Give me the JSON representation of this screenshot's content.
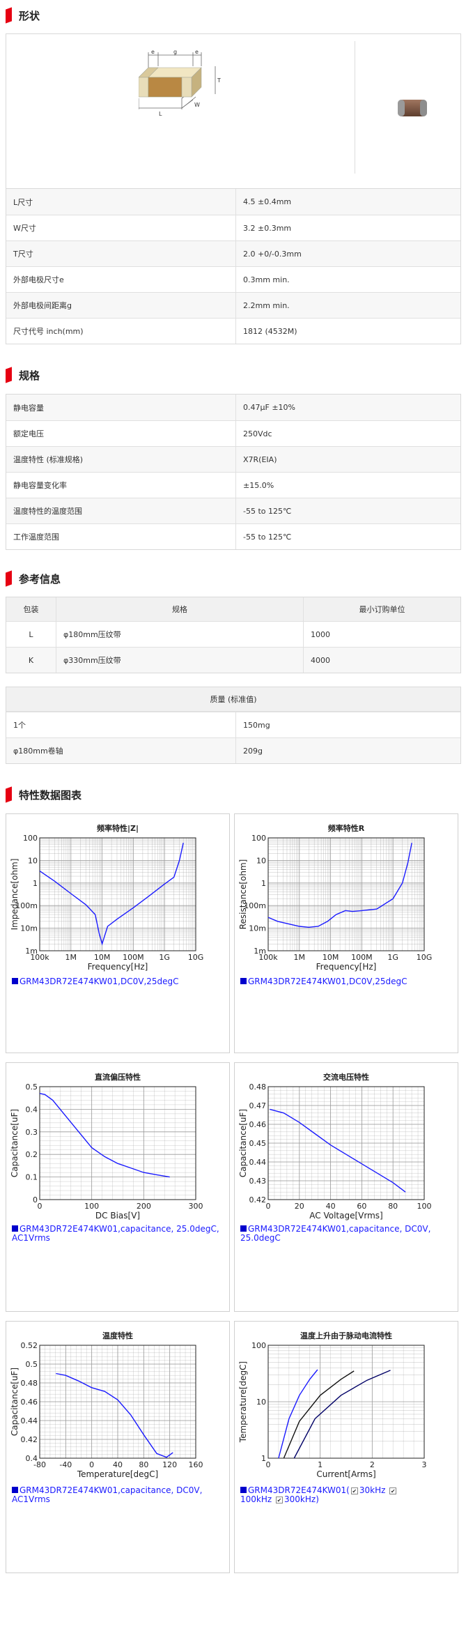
{
  "sections": {
    "shape": "形状",
    "spec": "规格",
    "ref": "参考信息",
    "charts": "特性数据图表"
  },
  "shape_rows": [
    {
      "label": "L尺寸",
      "value": "4.5 ±0.4mm"
    },
    {
      "label": "W尺寸",
      "value": "3.2 ±0.3mm"
    },
    {
      "label": "T尺寸",
      "value": "2.0 +0/-0.3mm"
    },
    {
      "label": "外部电极尺寸e",
      "value": "0.3mm min."
    },
    {
      "label": "外部电极间距离g",
      "value": "2.2mm min."
    },
    {
      "label": "尺寸代号 inch(mm)",
      "value": "1812 (4532M)"
    }
  ],
  "diagram_labels": {
    "e": "e",
    "g": "g",
    "T": "T",
    "L": "L",
    "W": "W"
  },
  "spec_rows": [
    {
      "label": "静电容量",
      "value": "0.47μF ±10%"
    },
    {
      "label": "额定电压",
      "value": "250Vdc"
    },
    {
      "label": "温度特性 (标准规格)",
      "value": "X7R(EIA)"
    },
    {
      "label": "静电容量变化率",
      "value": "±15.0%"
    },
    {
      "label": "温度特性的温度范围",
      "value": "-55 to 125℃"
    },
    {
      "label": "工作温度范围",
      "value": "-55 to 125℃"
    }
  ],
  "order_table": {
    "headers": [
      "包装",
      "规格",
      "最小订购单位"
    ],
    "rows": [
      {
        "pack": "L",
        "spec": "φ180mm压纹带",
        "moq": "1000"
      },
      {
        "pack": "K",
        "spec": "φ330mm压纹带",
        "moq": "4000"
      }
    ]
  },
  "mass_table": {
    "header": "质量 (标准值)",
    "rows": [
      {
        "label": "1个",
        "value": "150mg"
      },
      {
        "label": "φ180mm卷轴",
        "value": "209g"
      }
    ]
  },
  "charts": {
    "c1": {
      "title": "频率特性|Z|",
      "legend": "GRM43DR72E474KW01,DC0V,25degC"
    },
    "c2": {
      "title": "频率特性R",
      "legend": "GRM43DR72E474KW01,DC0V,25degC"
    },
    "c3": {
      "title": "直流偏压特性",
      "legend": "GRM43DR72E474KW01,capacitance, 25.0degC, AC1Vrms"
    },
    "c4": {
      "title": "交流电压特性",
      "legend": "GRM43DR72E474KW01,capacitance, DC0V, 25.0degC"
    },
    "c5": {
      "title": "温度特性",
      "legend": "GRM43DR72E474KW01,capacitance, DC0V, AC1Vrms"
    },
    "c6": {
      "title": "温度上升由于脉动电流特性",
      "legend_part": "GRM43DR72E474KW01(",
      "checks": [
        "30kHz",
        "100kHz",
        "300kHz)"
      ]
    }
  },
  "chart_data": [
    {
      "type": "line",
      "title": "频率特性|Z|",
      "xlabel": "Frequency[Hz]",
      "ylabel": "Impedance[ohm]",
      "x_scale": "log",
      "y_scale": "log",
      "xlim": [
        100000,
        10000000000
      ],
      "ylim": [
        0.001,
        100
      ],
      "xticks": [
        "100k",
        "1M",
        "10M",
        "100M",
        "1G",
        "10G"
      ],
      "yticks": [
        "100",
        "10",
        "1",
        "100m",
        "10m",
        "1m"
      ],
      "grid": true,
      "series": [
        {
          "x": [
            100000,
            300000,
            1000000,
            3000000,
            6000000,
            8000000,
            10000000,
            15000000,
            30000000,
            100000000,
            300000000,
            1000000000,
            2000000000,
            3000000000,
            4000000000
          ],
          "y": [
            3.4,
            1.2,
            0.34,
            0.11,
            0.04,
            0.006,
            0.002,
            0.012,
            0.025,
            0.08,
            0.25,
            0.9,
            1.8,
            10,
            60
          ]
        }
      ]
    },
    {
      "type": "line",
      "title": "频率特性R",
      "xlabel": "Frequency[Hz]",
      "ylabel": "Resistance[ohm]",
      "x_scale": "log",
      "y_scale": "log",
      "xlim": [
        100000,
        10000000000
      ],
      "ylim": [
        0.001,
        100
      ],
      "xticks": [
        "100k",
        "1M",
        "10M",
        "100M",
        "1G",
        "10G"
      ],
      "yticks": [
        "100",
        "10",
        "1",
        "100m",
        "10m",
        "1m"
      ],
      "grid": true,
      "series": [
        {
          "x": [
            100000,
            200000,
            500000,
            1000000,
            2000000,
            4000000,
            8000000,
            15000000,
            30000000,
            50000000,
            100000000,
            300000000,
            1000000000,
            2000000000,
            3000000000,
            4000000000
          ],
          "y": [
            0.03,
            0.02,
            0.015,
            0.012,
            0.011,
            0.012,
            0.02,
            0.04,
            0.06,
            0.055,
            0.06,
            0.07,
            0.2,
            1,
            8,
            60
          ]
        }
      ]
    },
    {
      "type": "line",
      "title": "直流偏压特性",
      "xlabel": "DC Bias[V]",
      "ylabel": "Capacitance[uF]",
      "xlim": [
        0,
        300
      ],
      "ylim": [
        0,
        0.5
      ],
      "xticks": [
        "0",
        "100",
        "200",
        "300"
      ],
      "yticks": [
        "0.5",
        "0.4",
        "0.3",
        "0.2",
        "0.1",
        "0"
      ],
      "grid": true,
      "series": [
        {
          "x": [
            0,
            10,
            25,
            50,
            75,
            100,
            125,
            150,
            175,
            200,
            225,
            250
          ],
          "y": [
            0.47,
            0.465,
            0.44,
            0.37,
            0.3,
            0.23,
            0.19,
            0.16,
            0.14,
            0.12,
            0.11,
            0.1
          ]
        }
      ]
    },
    {
      "type": "line",
      "title": "交流电压特性",
      "xlabel": "AC Voltage[Vrms]",
      "ylabel": "Capacitance[uF]",
      "xlim": [
        0,
        100
      ],
      "ylim": [
        0.42,
        0.48
      ],
      "xticks": [
        "0",
        "20",
        "40",
        "60",
        "80",
        "100"
      ],
      "yticks": [
        "0.48",
        "0.47",
        "0.46",
        "0.45",
        "0.44",
        "0.43",
        "0.42"
      ],
      "grid": true,
      "series": [
        {
          "x": [
            1,
            10,
            20,
            30,
            40,
            50,
            60,
            70,
            80,
            88
          ],
          "y": [
            0.468,
            0.466,
            0.461,
            0.455,
            0.449,
            0.444,
            0.439,
            0.434,
            0.429,
            0.424
          ]
        }
      ]
    },
    {
      "type": "line",
      "title": "温度特性",
      "xlabel": "Temperature[degC]",
      "ylabel": "Capacitance[uF]",
      "xlim": [
        -80,
        160
      ],
      "ylim": [
        0.4,
        0.52
      ],
      "xticks": [
        "-80",
        "-40",
        "0",
        "40",
        "80",
        "120",
        "160"
      ],
      "yticks": [
        "0.52",
        "0.5",
        "0.48",
        "0.46",
        "0.44",
        "0.42",
        "0.4"
      ],
      "grid": true,
      "series": [
        {
          "x": [
            -55,
            -40,
            -20,
            0,
            20,
            40,
            60,
            80,
            100,
            115,
            125
          ],
          "y": [
            0.49,
            0.488,
            0.482,
            0.475,
            0.471,
            0.462,
            0.446,
            0.425,
            0.405,
            0.401,
            0.406
          ]
        }
      ]
    },
    {
      "type": "line",
      "title": "温度上升由于脉动电流特性",
      "xlabel": "Current[Arms]",
      "ylabel": "Temperature[degC]",
      "x_scale": "linear",
      "y_scale": "log",
      "xlim": [
        0,
        3
      ],
      "ylim": [
        1,
        100
      ],
      "xticks": [
        "0",
        "1",
        "2",
        "3"
      ],
      "yticks": [
        "100",
        "10",
        "1"
      ],
      "grid": true,
      "series": [
        {
          "name": "30kHz",
          "x": [
            0.2,
            0.4,
            0.6,
            0.8,
            0.95
          ],
          "y": [
            1,
            5,
            13,
            25,
            37
          ]
        },
        {
          "name": "100kHz",
          "x": [
            0.3,
            0.6,
            1.0,
            1.4,
            1.65
          ],
          "y": [
            1,
            4.5,
            13,
            25,
            35
          ]
        },
        {
          "name": "300kHz",
          "x": [
            0.5,
            0.9,
            1.4,
            1.9,
            2.35
          ],
          "y": [
            1,
            5,
            13,
            24,
            36
          ]
        }
      ]
    }
  ]
}
